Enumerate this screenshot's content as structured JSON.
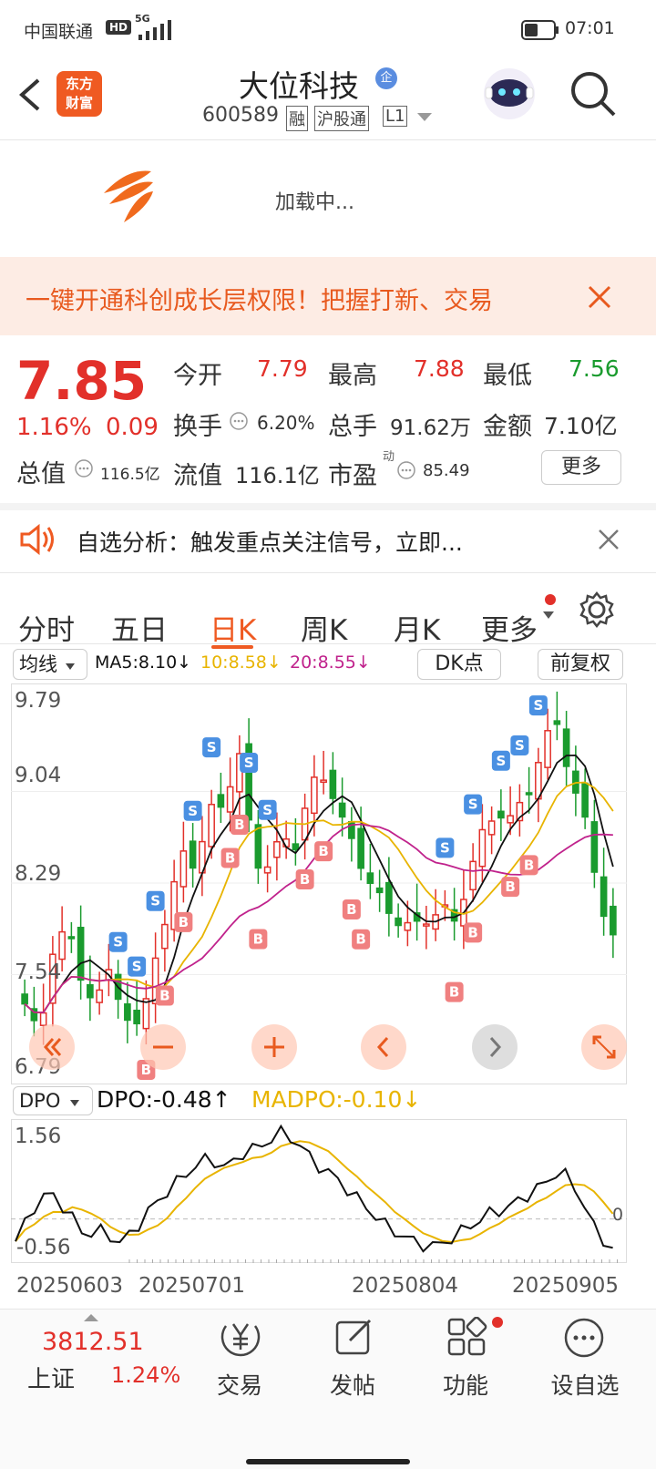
{
  "status_bar": {
    "carrier": "中国联通",
    "hd": "HD",
    "network": "5G",
    "time": "07:01"
  },
  "header": {
    "title": "大位科技",
    "badge": "企",
    "code": "600589",
    "tags": [
      "融",
      "沪股通",
      "L1"
    ],
    "logo_text": "东方\n财富"
  },
  "banner": {
    "loading": "加载中...",
    "promo": "一键开通科创成长层权限！把握打新、交易"
  },
  "quote": {
    "price": "7.85",
    "change_pct": "1.16%",
    "change": "0.09",
    "open_label": "今开",
    "open": "7.79",
    "high_label": "最高",
    "high": "7.88",
    "low_label": "最低",
    "low": "7.56",
    "turnover_label": "换手",
    "turnover": "6.20%",
    "volume_label": "总手",
    "volume": "91.62万",
    "amount_label": "金额",
    "amount": "7.10亿",
    "mcap_label": "总值",
    "mcap": "116.5亿",
    "float_label": "流值",
    "float": "116.1亿",
    "pe_label": "市盈",
    "pe_sup": "动",
    "pe": "85.49",
    "more": "更多"
  },
  "notice": {
    "text": "自选分析：触发重点关注信号，立即..."
  },
  "tabs": [
    "分时",
    "五日",
    "日K",
    "周K",
    "月K",
    "更多"
  ],
  "active_tab": "日K",
  "kline_bar": {
    "indicator": "均线",
    "ma5": "MA5:8.10↓",
    "ma10": "10:8.58↓",
    "ma20": "20:8.55↓",
    "dk": "DK点",
    "adjust": "前复权"
  },
  "chart_data": {
    "type": "candlestick",
    "y_labels": [
      "9.79",
      "9.04",
      "8.29",
      "7.54",
      "6.79"
    ],
    "ylim": [
      6.79,
      9.79
    ],
    "dpo_labels": {
      "top": "1.56",
      "bottom": "-0.56",
      "zero": "0"
    },
    "dpo_ylim": [
      -0.56,
      1.56
    ],
    "dates": [
      "20250603",
      "20250701",
      "20250804",
      "20250905"
    ],
    "indicator_bar": {
      "name": "DPO",
      "dpo": "DPO:-0.48↑",
      "madpo": "MADPO:-0.10↓"
    },
    "colors": {
      "up": "#e2302a",
      "down": "#1a9b2e",
      "ma5": "#111111",
      "ma10": "#e8b400",
      "ma20": "#c0228c"
    }
  },
  "bottom_nav": {
    "index_value": "3812.51",
    "index_name": "上证",
    "index_pct": "1.24%",
    "items": [
      {
        "label": "交易",
        "icon": "yen-icon"
      },
      {
        "label": "发帖",
        "icon": "edit-icon"
      },
      {
        "label": "功能",
        "icon": "grid-icon"
      },
      {
        "label": "设自选",
        "icon": "more-icon"
      }
    ]
  }
}
